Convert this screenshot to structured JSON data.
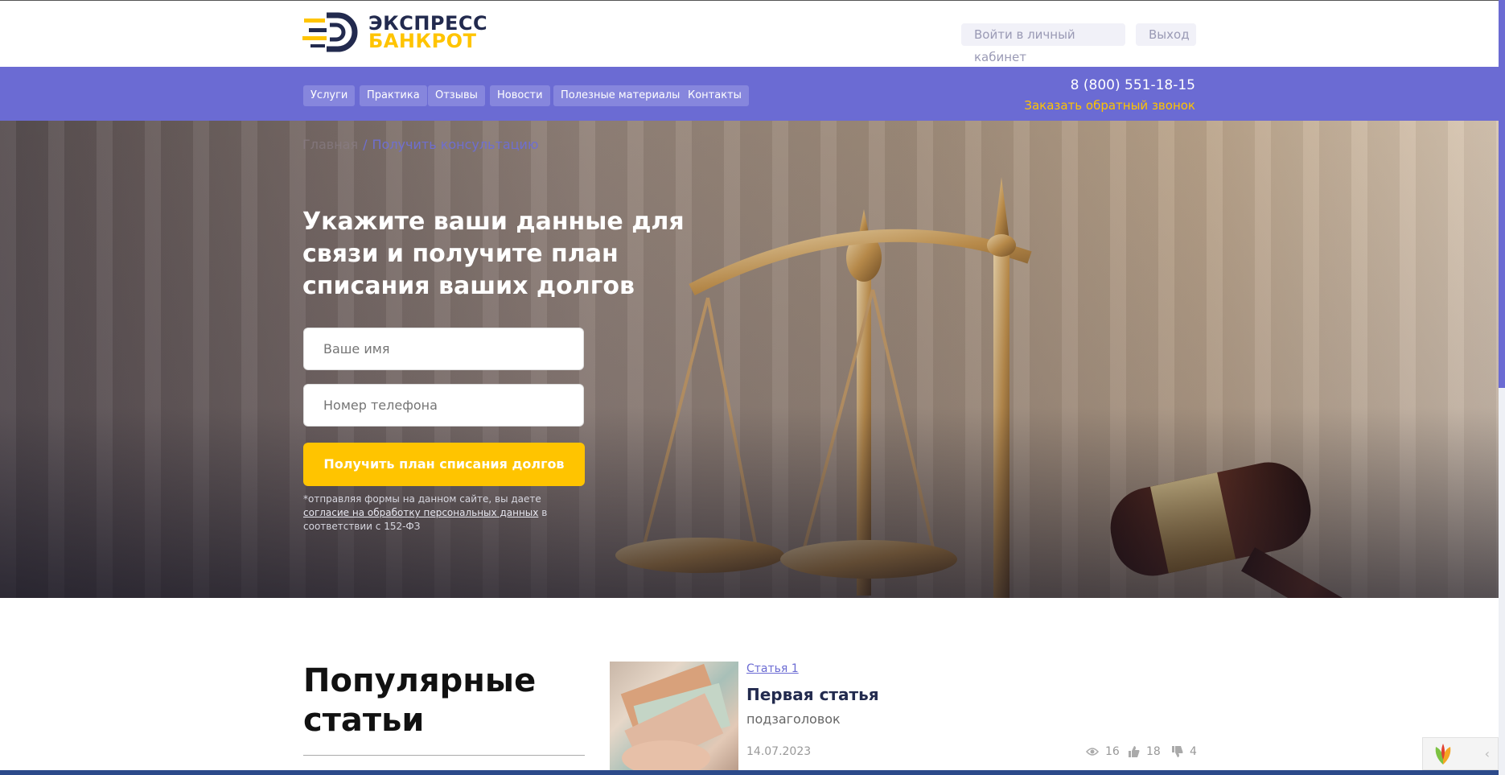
{
  "header": {
    "logo_line1": "ЭКСПРЕСС",
    "logo_line2": "БАНКРОТ",
    "login_label": "Войти в личный кабинет",
    "logout_label": "Выход"
  },
  "nav": {
    "items": [
      {
        "label": "Услуги"
      },
      {
        "label": "Практика"
      },
      {
        "label": "Отзывы"
      },
      {
        "label": "Новости"
      },
      {
        "label": "Полезные материалы"
      },
      {
        "label": "Контакты"
      }
    ],
    "phone": "8 (800) 551-18-15",
    "callback_label": "Заказать обратный звонок"
  },
  "hero": {
    "breadcrumb_home": "Главная",
    "breadcrumb_separator": "/",
    "breadcrumb_current": "Получить консультацию",
    "title": "Укажите ваши данные для связи и получите план списания ваших долгов",
    "name_placeholder": "Ваше имя",
    "phone_placeholder": "Номер телефона",
    "cta_label": "Получить план списания долгов",
    "consent_prefix": "*отправляя формы на данном сайте, вы даете ",
    "consent_link": "согласие на обработку персональных данных",
    "consent_suffix": " в соответствии с 152-ФЗ"
  },
  "popular": {
    "title": "Популярные статьи",
    "articles": [
      {
        "tag": "Статья 1",
        "title": "Первая статья",
        "subtitle": "подзаголовок",
        "date": "14.07.2023",
        "views": "16",
        "likes": "18",
        "dislikes": "4"
      }
    ]
  },
  "colors": {
    "accent": "#6b6bd3",
    "brand_yellow": "#ffc400",
    "brand_navy": "#222a4e"
  }
}
